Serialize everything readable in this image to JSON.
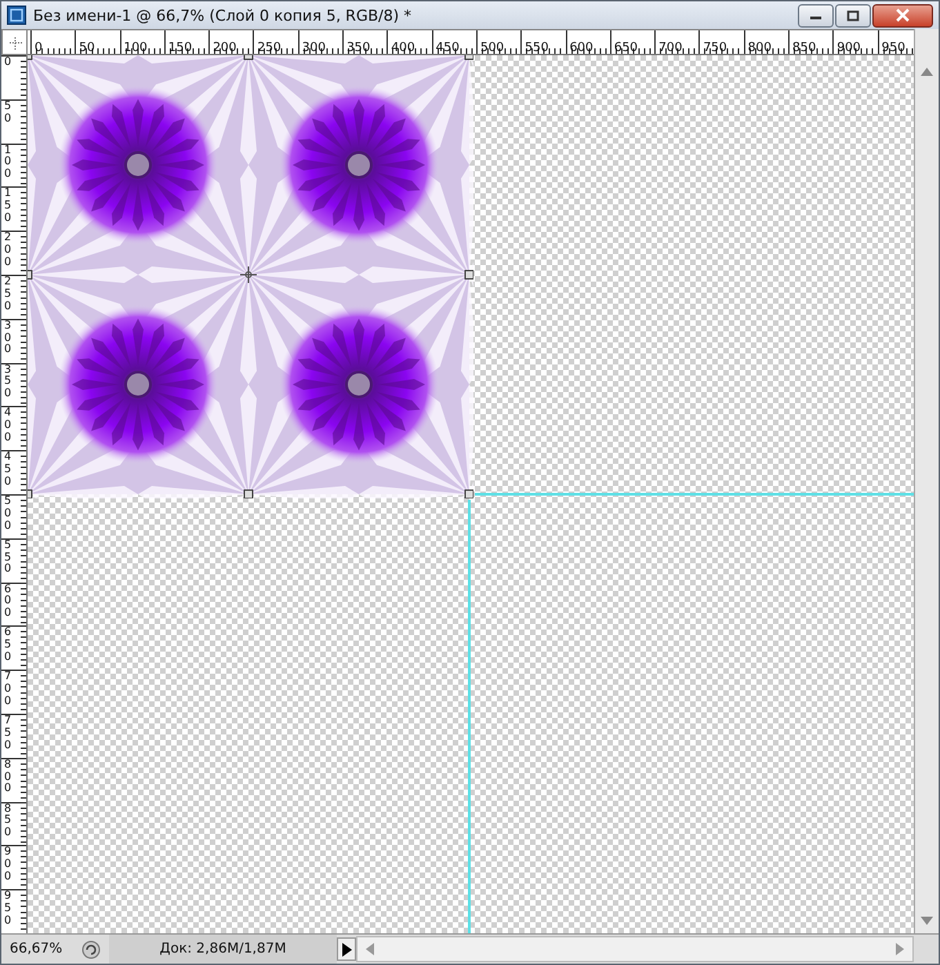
{
  "window": {
    "title": "Без имени-1 @ 66,7% (Слой 0 копия 5, RGB/8) *"
  },
  "ruler_horizontal": {
    "labels": [
      "0",
      "50",
      "100",
      "150",
      "200",
      "250",
      "300",
      "350",
      "400",
      "450",
      "500",
      "550",
      "600",
      "650",
      "700",
      "750",
      "800",
      "850",
      "900",
      "950"
    ]
  },
  "ruler_vertical": {
    "labels": [
      "0",
      "50",
      "100",
      "150",
      "200",
      "250",
      "300",
      "350",
      "400",
      "450",
      "500",
      "550",
      "600",
      "650",
      "700",
      "750",
      "800",
      "850",
      "900",
      "950"
    ]
  },
  "status_bar": {
    "zoom": "66,67%",
    "doc_info": "Док: 2,86M/1,87M"
  }
}
